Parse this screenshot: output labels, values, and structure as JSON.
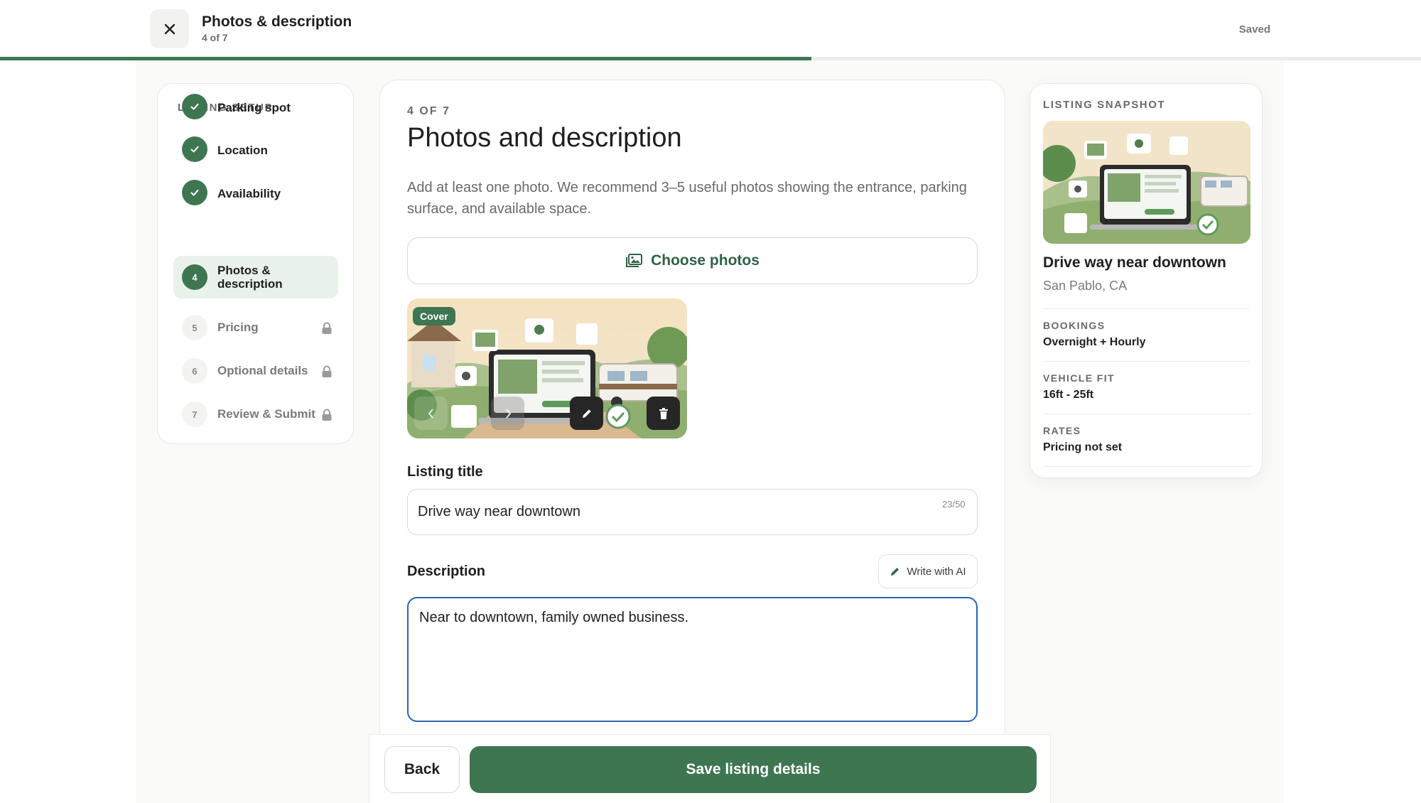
{
  "header": {
    "title": "Photos & description",
    "step_text": "4 of 7",
    "status": "Saved",
    "progress_fraction": 0.571
  },
  "sidebar": {
    "heading": "LISTING SETUP",
    "steps": [
      {
        "number": "1",
        "label": "Parking spot",
        "state": "done"
      },
      {
        "number": "2",
        "label": "Location",
        "state": "done"
      },
      {
        "number": "3",
        "label": "Availability",
        "state": "done"
      },
      {
        "number": "4",
        "label": "Photos & description",
        "state": "current"
      },
      {
        "number": "5",
        "label": "Pricing",
        "state": "locked"
      },
      {
        "number": "6",
        "label": "Optional details",
        "state": "locked"
      },
      {
        "number": "7",
        "label": "Review & Submit",
        "state": "locked"
      }
    ]
  },
  "main": {
    "kicker": "4 OF 7",
    "title": "Photos and description",
    "intro": "Add at least one photo. We recommend 3–5 useful photos showing the entrance, parking surface, and available space.",
    "choose_photos": "Choose photos",
    "photo": {
      "badge": "Cover"
    },
    "listing_title": {
      "label": "Listing title",
      "value": "Drive way near downtown",
      "counter": "23/50"
    },
    "description": {
      "label": "Description",
      "ai_button": "Write with AI",
      "value": "Near to downtown, family owned business."
    }
  },
  "footer": {
    "back": "Back",
    "save": "Save listing details"
  },
  "snapshot": {
    "heading": "LISTING SNAPSHOT",
    "title": "Drive way near downtown",
    "location": "San Pablo, CA",
    "fields": [
      {
        "key": "BOOKINGS",
        "value": "Overnight + Hourly"
      },
      {
        "key": "VEHICLE FIT",
        "value": "16ft - 25ft"
      },
      {
        "key": "RATES",
        "value": "Pricing not set"
      }
    ]
  },
  "colors": {
    "accent": "#3f7652",
    "focus": "#2a66b0"
  }
}
